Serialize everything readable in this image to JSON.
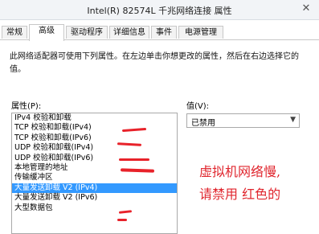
{
  "window": {
    "title": "Intel(R) 82574L 千兆网络连接 属性"
  },
  "tabs": [
    {
      "label": "常规"
    },
    {
      "label": "高级"
    },
    {
      "label": "驱动程序"
    },
    {
      "label": "详细信息"
    },
    {
      "label": "事件"
    },
    {
      "label": "电源管理"
    }
  ],
  "active_tab": "高级",
  "description": "此网络适配器可使用下列属性。在左边单击你想更改的属性，然后在右边选择它的值。",
  "property_label": "属性(P):",
  "value_label": "值(V):",
  "properties": [
    {
      "label": "IPv4 校验和卸载"
    },
    {
      "label": "TCP 校验和卸载(IPv4)"
    },
    {
      "label": "TCP 校验和卸载(IPv6)"
    },
    {
      "label": "UDP 校验和卸载(IPv4)"
    },
    {
      "label": "UDP 校验和卸载(IPv6)"
    },
    {
      "label": "本地管理的地址"
    },
    {
      "label": "传输缓冲区"
    },
    {
      "label": "大量发送卸载 V2 (IPv4)"
    },
    {
      "label": "大量发送卸载 V2 (IPv6)"
    },
    {
      "label": "大型数据包"
    }
  ],
  "selected_property": "大量发送卸载 V2 (IPv4)",
  "value_select": {
    "selected": "已禁用"
  },
  "annotation": {
    "line1": "虚拟机网络慢,",
    "line2": "请禁用  红色的"
  },
  "colors": {
    "highlight": "#3399ff",
    "annotation_red": "#e0262e"
  }
}
